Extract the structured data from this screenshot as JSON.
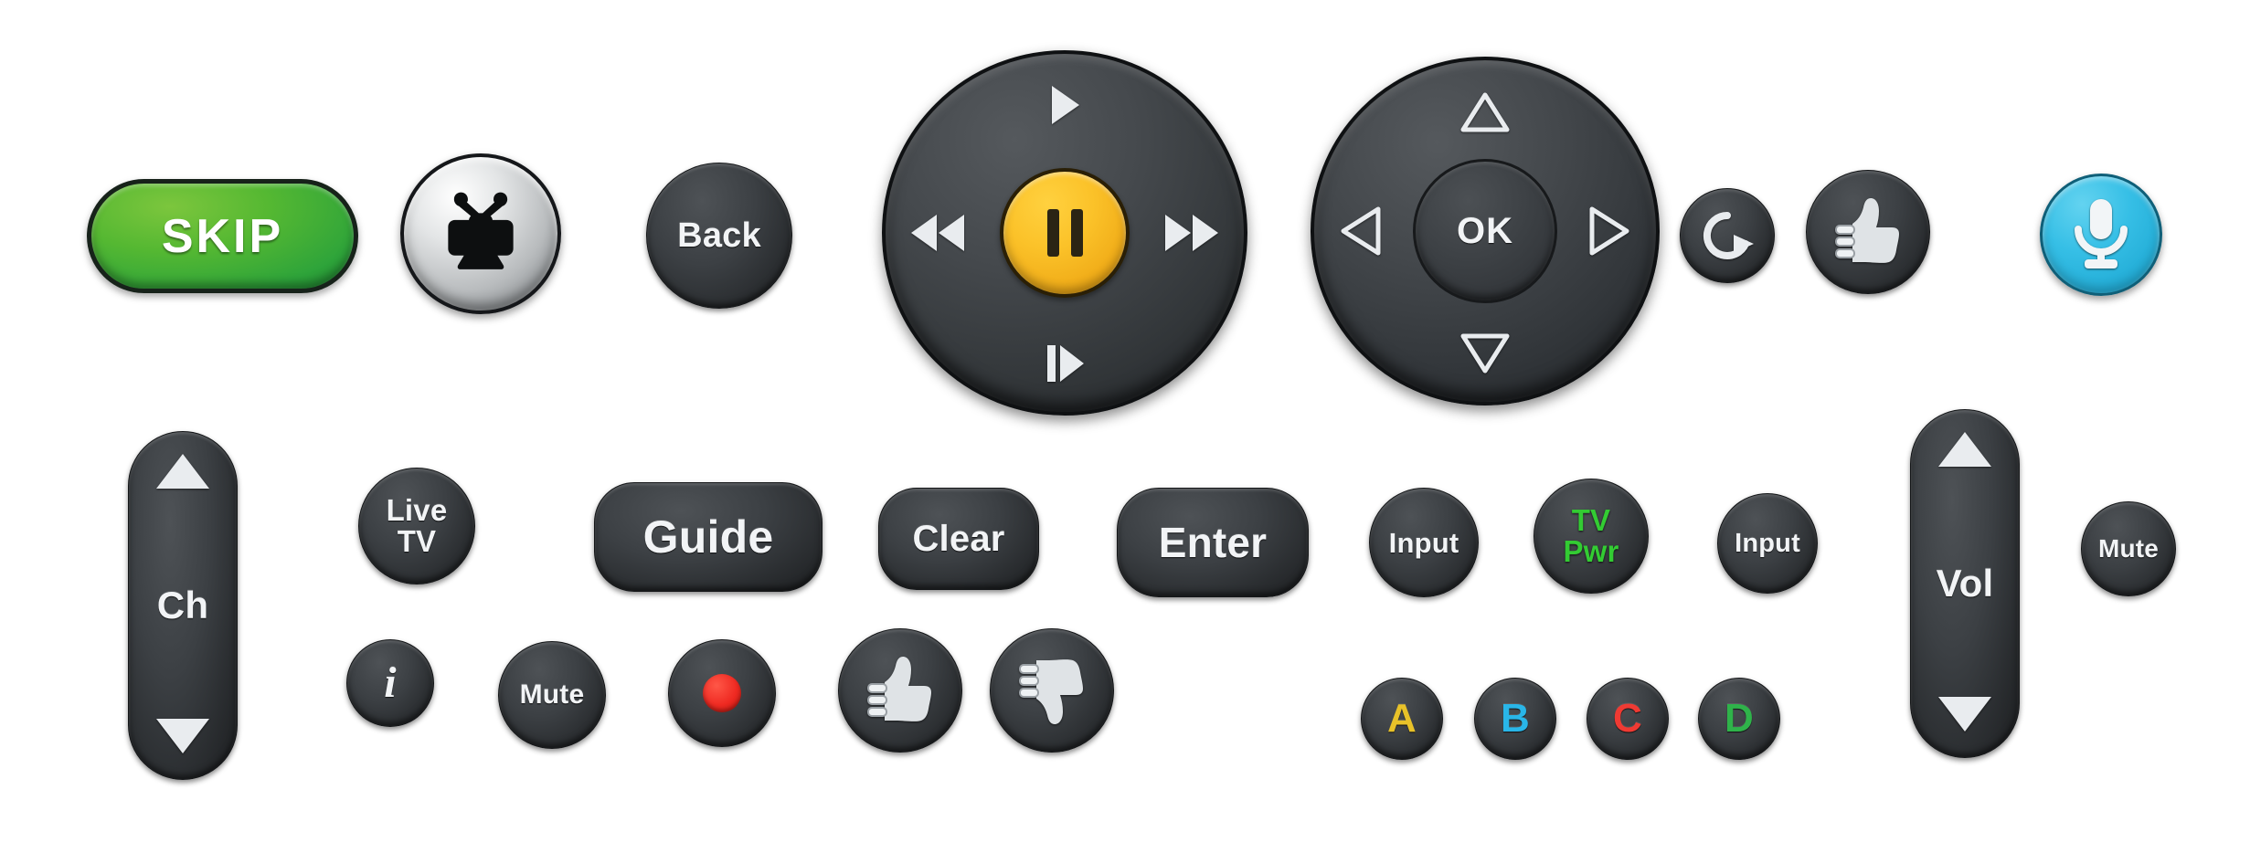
{
  "device": {
    "name": "TiVo remote control button set",
    "background": "#ffffff"
  },
  "colors": {
    "skip_green": "#2ea43a",
    "pause_yellow": "#fbc229",
    "mic_blue": "#2bb8e0",
    "record_red": "#ef2a22",
    "tv_pwr_green": "#33cc33",
    "a_yellow": "#e8c229",
    "b_blue": "#29b6e8",
    "c_red": "#ef3a33",
    "d_green": "#2fb34a",
    "button_dark": "#3c4044",
    "tivo_silver": "#c8cbcd"
  },
  "row1": {
    "skip": {
      "label": "SKIP",
      "name": "skip-button"
    },
    "tivo": {
      "icon": "tivo-logo-icon",
      "name": "tivo-button"
    },
    "back": {
      "label": "Back",
      "name": "back-button"
    },
    "playback_ring": {
      "name": "playback-control-ring",
      "play": {
        "icon": "play-icon",
        "label": "Play"
      },
      "rewind": {
        "icon": "rewind-icon",
        "label": "Rewind"
      },
      "forward": {
        "icon": "fast-forward-icon",
        "label": "Fast Forward"
      },
      "slow": {
        "icon": "slow-motion-icon",
        "label": "Slow / Frame Advance"
      },
      "pause": {
        "icon": "pause-icon",
        "label": "Pause"
      }
    },
    "dpad": {
      "name": "directional-pad",
      "up": {
        "icon": "arrow-up-icon",
        "label": "Up"
      },
      "down": {
        "icon": "arrow-down-icon",
        "label": "Down"
      },
      "left": {
        "icon": "arrow-left-icon",
        "label": "Left"
      },
      "right": {
        "icon": "arrow-right-icon",
        "label": "Right"
      },
      "ok": {
        "label": "OK"
      }
    },
    "replay": {
      "icon": "replay-icon",
      "label": "Replay"
    },
    "thumbs_up": {
      "icon": "thumbs-up-icon",
      "label": "Thumbs Up"
    },
    "mic": {
      "icon": "microphone-icon",
      "label": "Voice Search"
    }
  },
  "row2": {
    "ch_rocker": {
      "label": "Ch",
      "up": "▲",
      "down": "▼"
    },
    "live_tv": {
      "label": "Live\nTV"
    },
    "guide": {
      "label": "Guide"
    },
    "clear": {
      "label": "Clear"
    },
    "enter": {
      "label": "Enter"
    },
    "input_1": {
      "label": "Input"
    },
    "tv_pwr": {
      "label": "TV\nPwr"
    },
    "input_2": {
      "label": "Input"
    },
    "vol_rocker": {
      "label": "Vol",
      "up": "▲",
      "down": "▼"
    },
    "mute_right": {
      "label": "Mute"
    }
  },
  "row3": {
    "info": {
      "label": "i"
    },
    "mute": {
      "label": "Mute"
    },
    "record": {
      "icon": "record-icon",
      "label": "Record"
    },
    "thumbs_up": {
      "icon": "thumbs-up-icon",
      "label": "Thumbs Up"
    },
    "thumbs_down": {
      "icon": "thumbs-down-icon",
      "label": "Thumbs Down"
    },
    "color_buttons": [
      {
        "label": "A",
        "color": "#e8c229"
      },
      {
        "label": "B",
        "color": "#29b6e8"
      },
      {
        "label": "C",
        "color": "#ef3a33"
      },
      {
        "label": "D",
        "color": "#2fb34a"
      }
    ]
  }
}
